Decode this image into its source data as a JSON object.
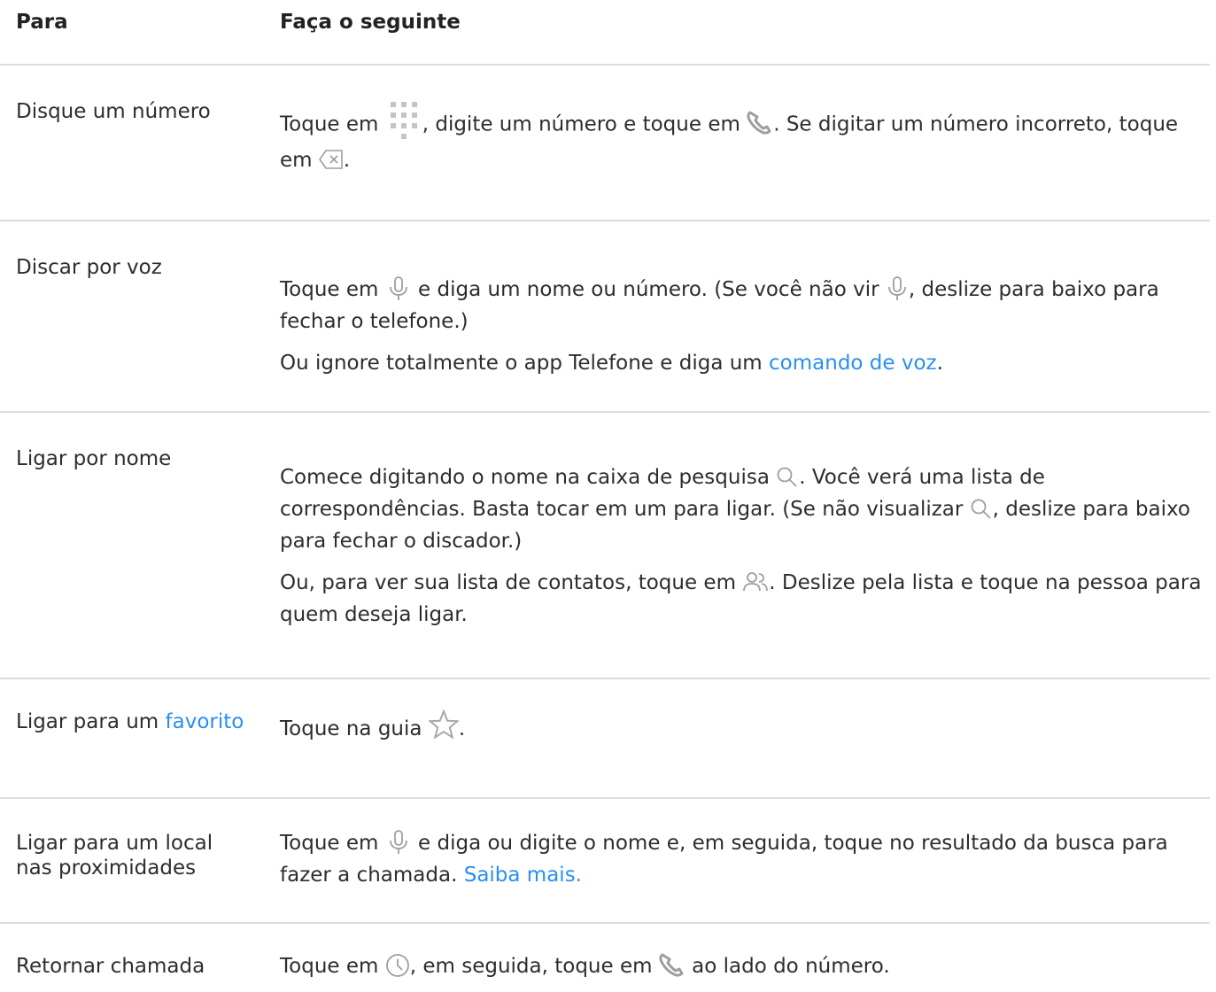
{
  "header": {
    "col1": "Para",
    "col2": "Faça o seguinte"
  },
  "rows": [
    {
      "label": "Disque um número",
      "p1": {
        "a": "Toque em ",
        "b": ", digite um número e toque em ",
        "c": ". Se digitar um número incorreto, toque em ",
        "d": "."
      }
    },
    {
      "label": "Discar por voz",
      "p1": {
        "a": "Toque em ",
        "b": " e diga um nome ou número. (Se você não vir ",
        "c": ", deslize para baixo para fechar o telefone.)"
      },
      "p2": {
        "a": "Ou ignore totalmente o app Telefone e diga um ",
        "link": "comando de voz",
        "b": "."
      }
    },
    {
      "label": "Ligar por nome",
      "p1": {
        "a": "Comece digitando o nome na caixa de pesquisa ",
        "b": ". Você verá uma lista de correspondências. Basta tocar em um para ligar. (Se não visualizar ",
        "c": ", deslize para baixo para fechar o discador.)"
      },
      "p2": {
        "a": "Ou, para ver sua lista de contatos, toque em ",
        "b": ". Deslize pela lista e toque na pessoa para quem deseja ligar."
      }
    },
    {
      "label_a": "Ligar para um ",
      "label_link": "favorito",
      "p1": {
        "a": "Toque na guia ",
        "b": "."
      }
    },
    {
      "label": "Ligar para um local nas proximidades",
      "p1": {
        "a": "Toque em ",
        "b": " e diga ou digite o nome e, em seguida, toque no resultado da busca para fazer a chamada. ",
        "link": "Saiba mais."
      }
    },
    {
      "label": "Retornar chamada",
      "p1": {
        "a": "Toque em ",
        "b": ", em seguida, toque em ",
        "c": " ao lado do número."
      }
    }
  ],
  "icons": {
    "dialpad": "dialpad-icon",
    "phone": "phone-icon",
    "backspace": "backspace-icon",
    "mic": "microphone-icon",
    "search": "search-icon",
    "contacts": "contacts-icon",
    "star": "star-icon",
    "clock": "clock-icon"
  },
  "colors": {
    "link": "#2a8ff0",
    "icon": "#9e9e9e",
    "divider": "#dcdcdc"
  }
}
